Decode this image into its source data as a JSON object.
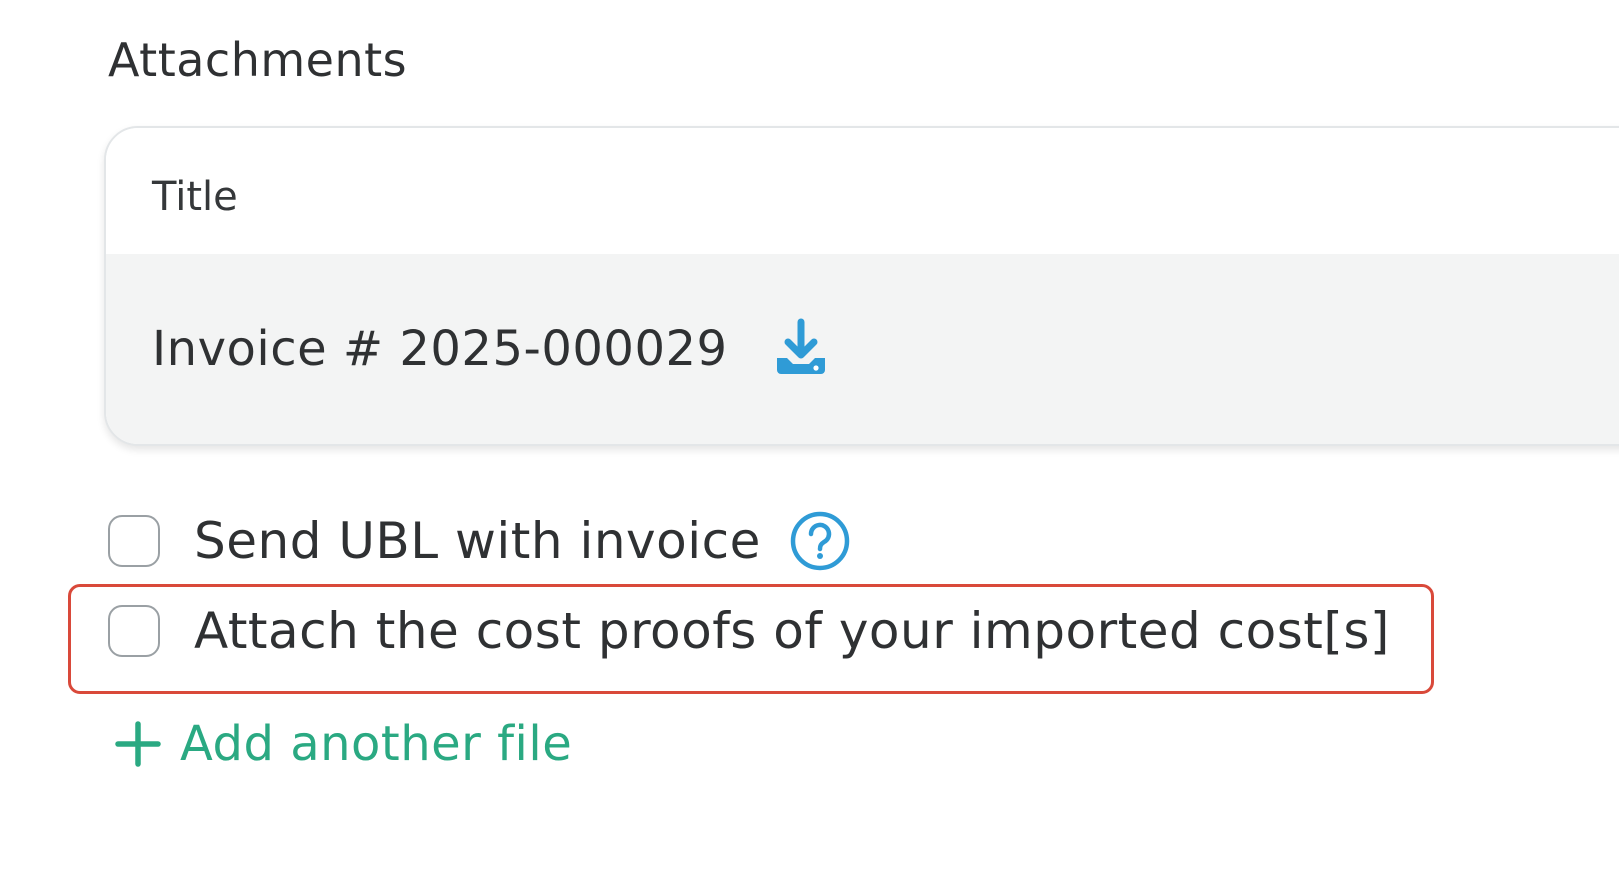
{
  "attachments": {
    "section_title": "Attachments",
    "table": {
      "column_header": "Title",
      "rows": [
        {
          "file_name": "Invoice # 2025-000029",
          "action_icon": "download-icon"
        }
      ]
    },
    "options": {
      "send_ubl": {
        "label": "Send UBL with invoice",
        "checked": false,
        "help_icon": "question-circle-icon"
      },
      "attach_cost_proofs": {
        "label": "Attach the cost proofs of your imported cost[s]",
        "checked": false
      }
    },
    "add_file": {
      "label": "Add another file",
      "icon": "plus-icon"
    }
  },
  "colors": {
    "accent_blue": "#2f9bd6",
    "accent_green": "#2aa982",
    "highlight_red": "#d9493a",
    "row_background": "#f3f4f4"
  }
}
